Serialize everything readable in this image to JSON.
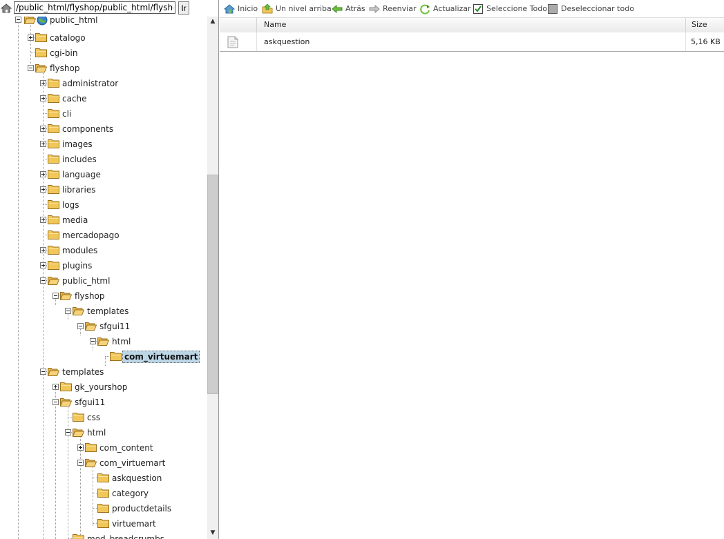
{
  "path_bar": {
    "value": "/public_html/flyshop/public_html/flyshop/",
    "go_label": "Ir"
  },
  "toolbar": {
    "home": "Inicio",
    "up": "Un nivel arriba",
    "back": "Atrás",
    "forward": "Reenviar",
    "refresh": "Actualizar",
    "select_all": "Seleccione Todo",
    "deselect_all": "Deseleccionar todo"
  },
  "grid": {
    "columns": {
      "name": "Name",
      "size": "Size"
    },
    "rows": [
      {
        "name": "askquestion",
        "size": "5,16 KB"
      }
    ]
  },
  "tree": {
    "root": "public_html",
    "catalogo": "catalogo",
    "cgi_bin": "cgi-bin",
    "flyshop": "flyshop",
    "administrator": "administrator",
    "cache": "cache",
    "cli": "cli",
    "components": "components",
    "images": "images",
    "includes": "includes",
    "language": "language",
    "libraries": "libraries",
    "logs": "logs",
    "media": "media",
    "mercadopago": "mercadopago",
    "modules": "modules",
    "plugins": "plugins",
    "public_html": "public_html",
    "pf_flyshop": "flyshop",
    "pf_templates": "templates",
    "pf_sfgui11": "sfgui11",
    "pf_html": "html",
    "pf_com_virtuemart": "com_virtuemart",
    "templates": "templates",
    "gk_yourshop": "gk_yourshop",
    "sfgui11": "sfgui11",
    "css": "css",
    "html": "html",
    "com_content": "com_content",
    "com_virtuemart": "com_virtuemart",
    "askquestion": "askquestion",
    "category": "category",
    "productdetails": "productdetails",
    "virtuemart": "virtuemart",
    "mod_breadcrumbs": "mod_breadcrumbs"
  },
  "colors": {
    "selection": "#bcd6e6",
    "folder": "#f1c75a"
  }
}
